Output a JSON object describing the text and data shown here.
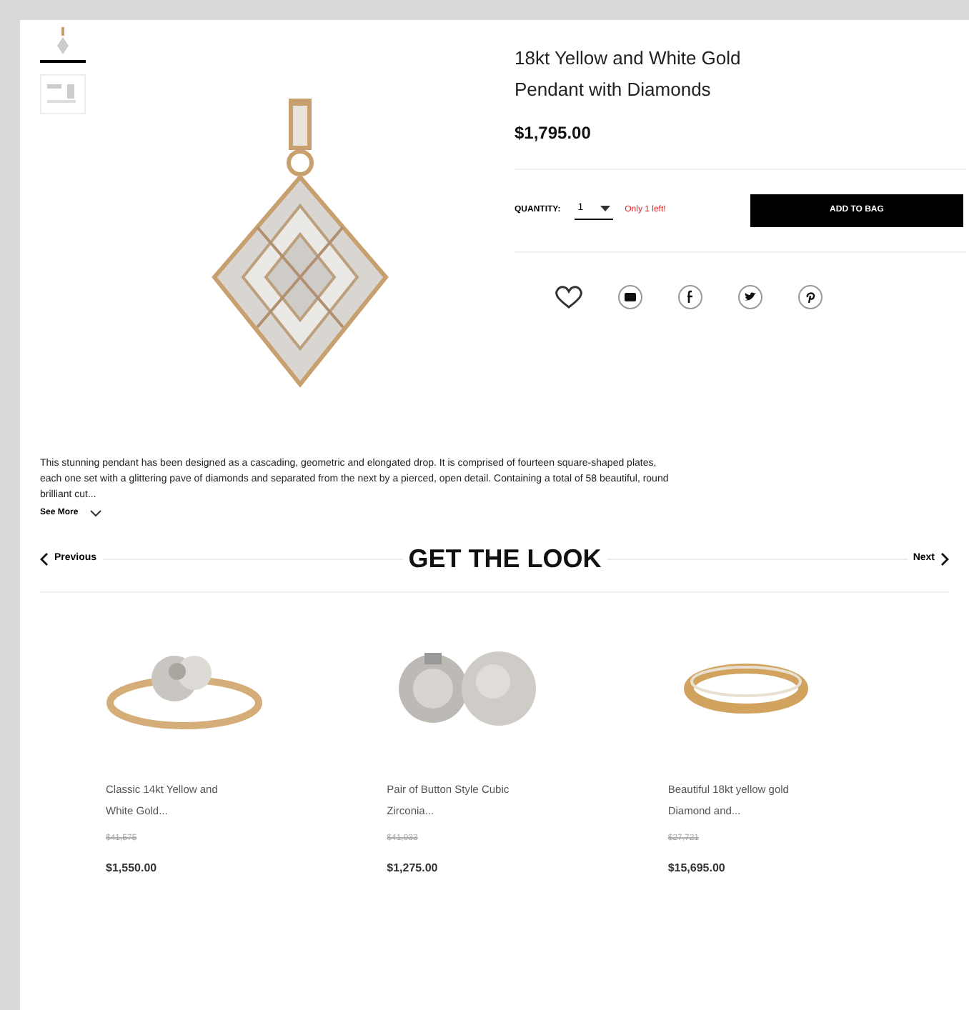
{
  "thumbnails": [
    {
      "selected": true
    },
    {
      "selected": false
    }
  ],
  "product": {
    "title": "18kt Yellow and White Gold Pendant with Diamonds",
    "price": "$1,795.00",
    "quantity_label": "QUANTITY:",
    "quantity": "1",
    "stock": "Only 1 left!",
    "add_button": "ADD TO BAG"
  },
  "share": [
    {
      "kind": "heart"
    },
    {
      "kind": "email"
    },
    {
      "kind": "facebook"
    },
    {
      "kind": "twitter"
    },
    {
      "kind": "pinterest"
    }
  ],
  "description": "This stunning pendant has been designed as a cascading, geometric and elongated drop. It is comprised of fourteen square-shaped plates, each one set with a glittering pave of diamonds and separated from the next by a pierced, open detail. Containing a total of 58 beautiful, round brilliant cut...",
  "see_more": "See More",
  "look": {
    "title": "GET THE LOOK",
    "previous": "Previous",
    "next": "Next"
  },
  "items": [
    {
      "kind": "ring",
      "name": "Classic 14kt Yellow and White Gold...",
      "old_price": "$41,575",
      "price": "$1,550.00"
    },
    {
      "kind": "earrings",
      "name": "Pair of Button Style Cubic Zirconia...",
      "old_price": "$41,933",
      "price": "$1,275.00"
    },
    {
      "kind": "band",
      "name": "Beautiful 18kt yellow gold Diamond and...",
      "old_price": "$27,721",
      "price": "$15,695.00"
    }
  ]
}
